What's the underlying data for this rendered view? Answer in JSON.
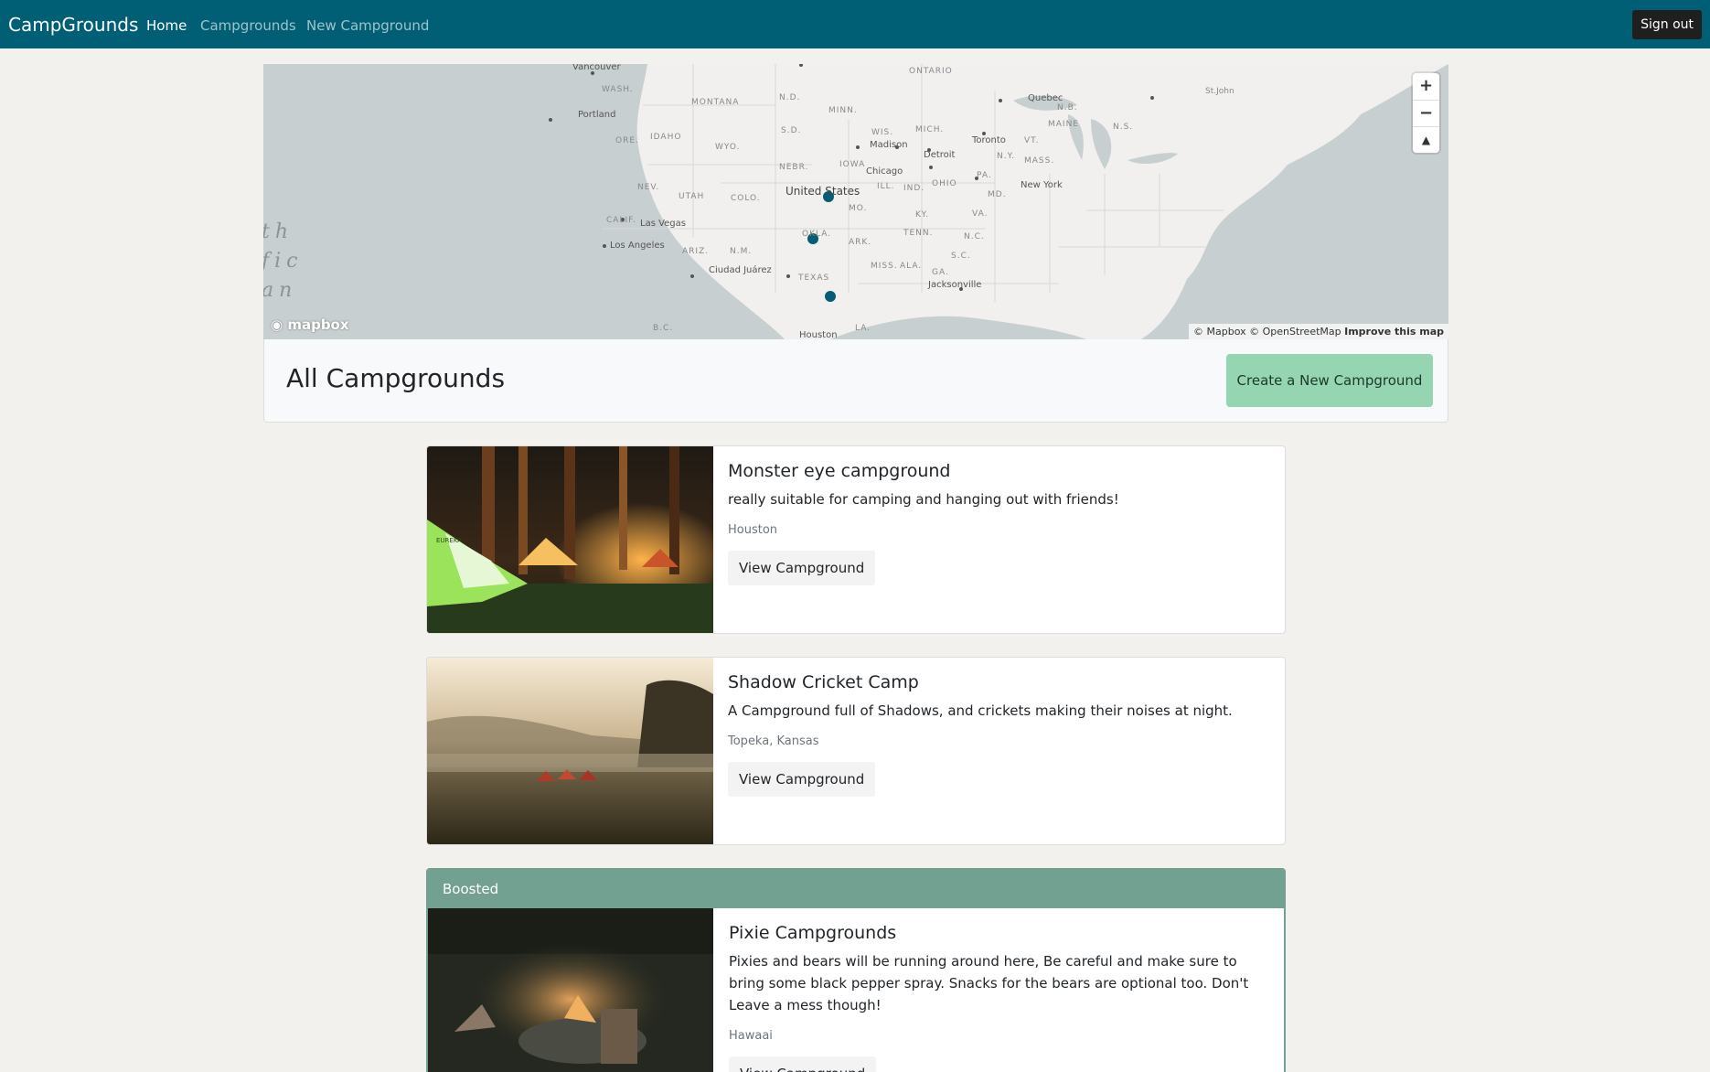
{
  "navbar": {
    "brand": "CampGrounds",
    "links": [
      "Home",
      "Campgrounds",
      "New Campground"
    ],
    "signout_label": "Sign out",
    "color": "#005f74"
  },
  "map": {
    "attribution_mapbox": "© Mapbox",
    "attribution_osm": "© OpenStreetMap",
    "attribution_improve": "Improve this map",
    "logo_label": "mapbox",
    "ocean_label": [
      "th",
      "fic",
      "an"
    ],
    "controls": {
      "zoom_in_icon": "plus-icon",
      "zoom_out_icon": "minus-icon",
      "compass_icon": "compass-icon"
    },
    "labels": {
      "vancouver": "Vancouver",
      "wash": "WASH.",
      "montana": "MONTANA",
      "nd": "N.D.",
      "minn": "MINN.",
      "ontario": "ONTARIO",
      "quebec": "Quebec",
      "stjohn": "St.John",
      "nb": "N.B.",
      "maine": "MAINE",
      "ns": "N.S.",
      "portland": "Portland",
      "ore": "ORE.",
      "idaho": "IDAHO",
      "sd": "S.D.",
      "wyo": "WYO.",
      "wis": "WIS.",
      "mich": "MICH.",
      "madison": "Madison",
      "toronto": "Toronto",
      "vt": "VT.",
      "ny": "N.Y.",
      "mass": "MASS.",
      "detroit": "Detroit",
      "nebr": "NEBR.",
      "iowa": "IOWA",
      "chicago": "Chicago",
      "pa": "PA.",
      "newyork": "New York",
      "unitedstates": "United States",
      "nev": "NEV.",
      "utah": "UTAH",
      "colo": "COLO.",
      "ill": "ILL.",
      "ind": "IND.",
      "ohio": "OHIO",
      "md": "MD.",
      "mo": "MO.",
      "ky": "KY.",
      "va": "VA.",
      "calif": "CALIF.",
      "lasvegas": "Las Vegas",
      "okla": "OKLA.",
      "tenn": "TENN.",
      "nc": "N.C.",
      "losangeles": "Los Angeles",
      "ariz": "ARIZ.",
      "nm": "N.M.",
      "ark": "ARK.",
      "sc": "S.C.",
      "miss": "MISS.",
      "ala": "ALA.",
      "ga": "GA.",
      "ciudadjuarez": "Ciudad Juárez",
      "texas": "TEXAS",
      "jacksonville": "Jacksonville",
      "houston": "Houston",
      "la": "LA.",
      "bc": "B.C."
    }
  },
  "header": {
    "title": "All Campgrounds",
    "create_button": "Create a New Campground"
  },
  "campgrounds": [
    {
      "title": "Monster eye campground",
      "description": "really suitable for camping and hanging out with friends!",
      "location": "Houston",
      "button": "View Campground",
      "image_logo": "EUREKA"
    },
    {
      "title": "Shadow Cricket Camp",
      "description": "A Campground full of Shadows, and crickets making their noises at night.",
      "location": "Topeka, Kansas",
      "button": "View Campground"
    },
    {
      "badge": "Boosted",
      "title": "Pixie Campgrounds",
      "description": "Pixies and bears will be running around here, Be careful and make sure to bring some black pepper spray. Snacks for the bears are optional too. Don't Leave a mess though!",
      "location": "Hawaai",
      "button": "View Campground"
    }
  ]
}
